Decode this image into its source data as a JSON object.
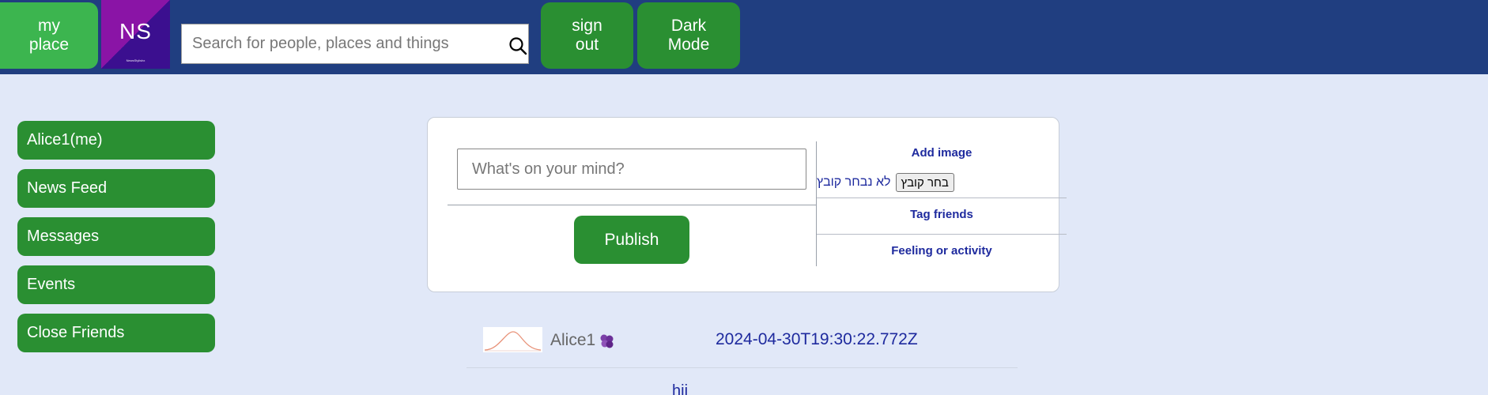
{
  "topbar": {
    "my_place_label": "my\nplace",
    "logo_text": "NS",
    "logo_tiny_text": "NewsStylishx",
    "search_placeholder": "Search for people, places and things",
    "sign_out_label": "sign\nout",
    "dark_mode_label": "Dark\nMode",
    "colors": {
      "bar": "#203e80",
      "green": "#2a8f32",
      "light_green": "#3cb54f"
    }
  },
  "sidebar": {
    "items": [
      {
        "label": "Alice1(me)"
      },
      {
        "label": "News Feed"
      },
      {
        "label": "Messages"
      },
      {
        "label": "Events"
      },
      {
        "label": "Close Friends"
      }
    ]
  },
  "composer": {
    "placeholder": "What's on your mind?",
    "publish_label": "Publish",
    "add_image_label": "Add image",
    "file_button_label": "בחר קובץ",
    "file_status": "לא נבחר קובץ",
    "tag_friends_label": "Tag friends",
    "feeling_label": "Feeling or activity"
  },
  "post": {
    "author": "Alice1",
    "timestamp": "2024-04-30T19:30:22.772Z",
    "body": "hii",
    "emoji_icon": "purple-flower-icon"
  }
}
